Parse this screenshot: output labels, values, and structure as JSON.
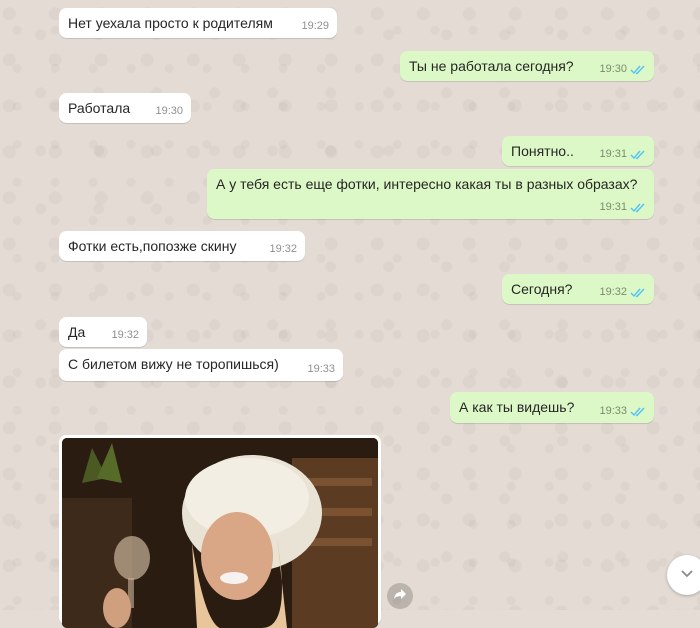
{
  "chat": {
    "messages": [
      {
        "text": "Нет уехала просто к родителям",
        "time": "19:29",
        "direction": "in"
      },
      {
        "text": "Ты не работала сегодня?",
        "time": "19:30",
        "direction": "out",
        "status": "read"
      },
      {
        "text": "Работала",
        "time": "19:30",
        "direction": "in"
      },
      {
        "text": "Понятно..",
        "time": "19:31",
        "direction": "out",
        "status": "read"
      },
      {
        "text": "А у тебя есть еще фотки, интересно какая ты в разных образах?",
        "time": "19:31",
        "direction": "out",
        "status": "read"
      },
      {
        "text": "Фотки есть,попозже скину",
        "time": "19:32",
        "direction": "in"
      },
      {
        "text": "Сегодня?",
        "time": "19:32",
        "direction": "out",
        "status": "read"
      },
      {
        "text": "Да",
        "time": "19:32",
        "direction": "in"
      },
      {
        "text": "С билетом вижу не торопишься)",
        "time": "19:33",
        "direction": "in"
      },
      {
        "text": "А как ты видешь?",
        "time": "19:33",
        "direction": "out",
        "status": "read"
      }
    ],
    "photo_message": {
      "direction": "in"
    }
  },
  "icons": {
    "read_ticks": "double-check-icon",
    "forward": "forward-icon",
    "scroll_down": "chevron-down-icon"
  },
  "colors": {
    "incoming_bubble": "#ffffff",
    "outgoing_bubble": "#dcf8c6",
    "read_tick": "#4fc3f7",
    "wallpaper": "#e5ddd5"
  }
}
